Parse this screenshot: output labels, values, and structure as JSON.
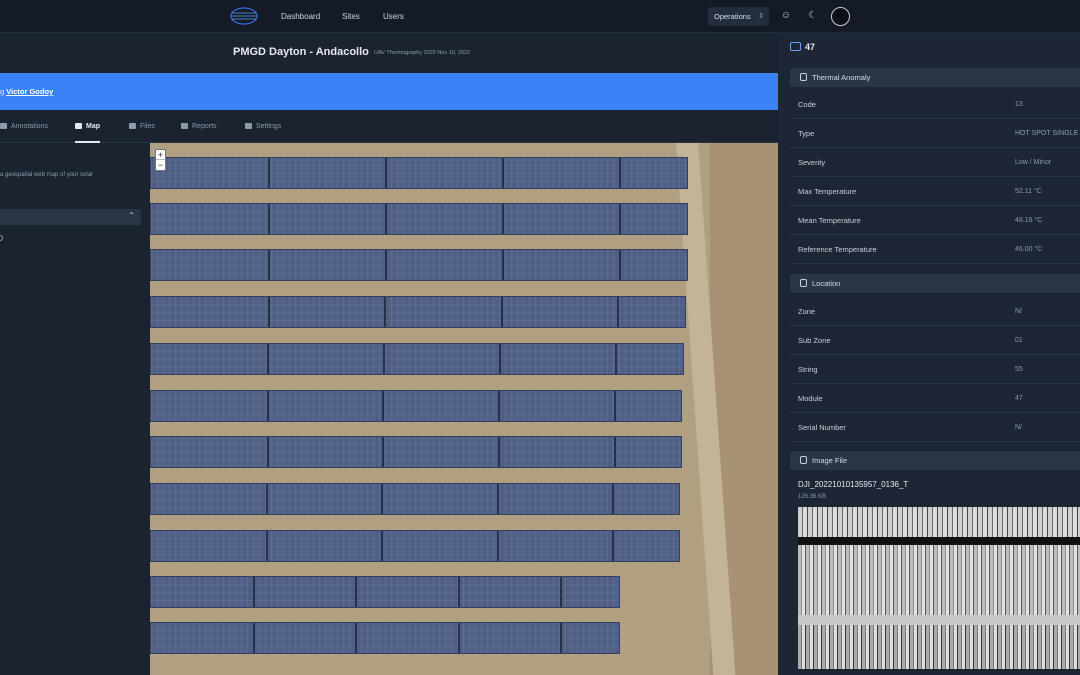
{
  "nav": {
    "dashboard": "Dashboard",
    "sites": "Sites",
    "users": "Users",
    "operations": "Operations"
  },
  "site": {
    "title": "PMGD Dayton - Andacollo",
    "subtitle": "UAV Thermography 2022 Nov 10, 2022"
  },
  "banner": {
    "prefix": "g ",
    "link": "Victor Godoy"
  },
  "tabs": [
    {
      "label": "Annotations",
      "icon": "annotations-icon"
    },
    {
      "label": "Map",
      "icon": "map-icon"
    },
    {
      "label": "Files",
      "icon": "files-icon"
    },
    {
      "label": "Reports",
      "icon": "reports-icon"
    },
    {
      "label": "Settings",
      "icon": "wrench-icon"
    }
  ],
  "sidebar": {
    "description": "a geospatial web map of your solar"
  },
  "map": {
    "zoom_in": "+",
    "zoom_out": "−"
  },
  "panel": {
    "id": "47",
    "thermal_title": "Thermal Anomaly",
    "thermal": [
      {
        "key": "Code",
        "value": "13"
      },
      {
        "key": "Type",
        "value": "HOT SPOT SINGLE"
      },
      {
        "key": "Severity",
        "value": "Low / Minor"
      },
      {
        "key": "Max Temperature",
        "value": "52.11 °C"
      },
      {
        "key": "Mean Temperature",
        "value": "48.16 °C"
      },
      {
        "key": "Reference Temperature",
        "value": "46.00 °C"
      }
    ],
    "location_title": "Location",
    "location": [
      {
        "key": "Zone",
        "value": "N/"
      },
      {
        "key": "Sub Zone",
        "value": "01"
      },
      {
        "key": "String",
        "value": "55"
      },
      {
        "key": "Module",
        "value": "47"
      },
      {
        "key": "Serial Number",
        "value": "N/"
      }
    ],
    "image_title": "Image File",
    "file_name": "DJI_20221010135957_0136_T",
    "file_size": "126.36 KB"
  },
  "colors": {
    "accent": "#3b82f6",
    "background": "#1b2331",
    "panel": "#1e2635"
  }
}
